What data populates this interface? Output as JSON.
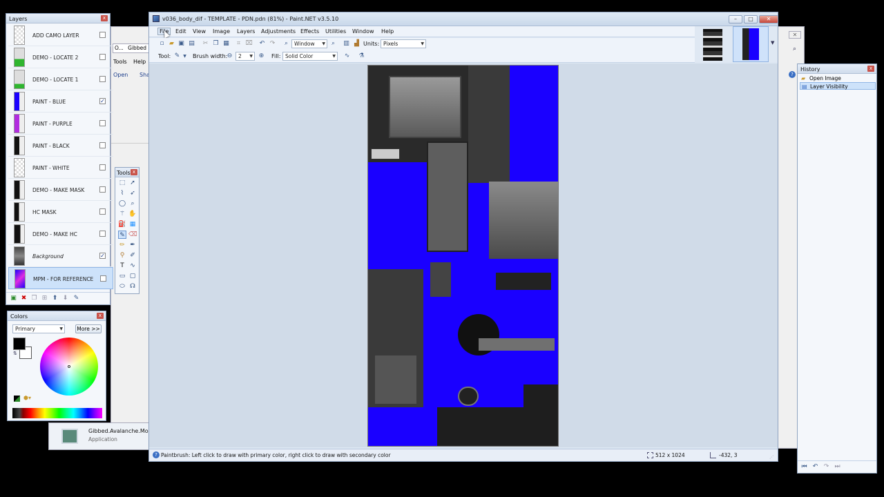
{
  "background": {
    "explorer_address": "Gibbed",
    "explorer_address_prefix": "O...",
    "explorer_menu": [
      "Tools",
      "Help"
    ],
    "explorer_toolbar": [
      "Open",
      "Sha"
    ],
    "taskbar_item_title": "Gibbed.Avalanche.Mod",
    "taskbar_item_subtitle": "Application"
  },
  "window": {
    "title": "v036_body_dif - TEMPLATE - PDN.pdn (81%) - Paint.NET v3.5.10",
    "min": "–",
    "max": "□",
    "close": "✕"
  },
  "menu": [
    "File",
    "Edit",
    "View",
    "Image",
    "Layers",
    "Adjustments",
    "Effects",
    "Utilities",
    "Window",
    "Help"
  ],
  "toolbar": {
    "zoom_mode": "Window",
    "units_label": "Units:",
    "units_value": "Pixels",
    "tool_label": "Tool:",
    "brush_width_label": "Brush width:",
    "brush_width_value": "2",
    "fill_label": "Fill:",
    "fill_value": "Solid Color"
  },
  "status": {
    "hint": "Paintbrush: Left click to draw with primary color, right click to draw with secondary color",
    "image_size": "512 x 1024",
    "cursor": "-432, 3"
  },
  "layers_panel": {
    "title": "Layers",
    "close": "x",
    "items": [
      {
        "name": "ADD CAMO LAYER",
        "checked": ""
      },
      {
        "name": "DEMO - LOCATE 2",
        "checked": ""
      },
      {
        "name": "DEMO - LOCATE 1",
        "checked": ""
      },
      {
        "name": "PAINT - BLUE",
        "checked": "✓"
      },
      {
        "name": "PAINT - PURPLE",
        "checked": ""
      },
      {
        "name": "PAINT - BLACK",
        "checked": ""
      },
      {
        "name": "PAINT - WHITE",
        "checked": ""
      },
      {
        "name": "DEMO - MAKE MASK",
        "checked": ""
      },
      {
        "name": "HC MASK",
        "checked": ""
      },
      {
        "name": "DEMO - MAKE HC",
        "checked": ""
      },
      {
        "name": "Background",
        "checked": "✓"
      },
      {
        "name": "MPM - FOR REFERENCE",
        "checked": ""
      }
    ]
  },
  "tools_panel": {
    "title": "Tools",
    "close": "x"
  },
  "colors_panel": {
    "title": "Colors",
    "close": "x",
    "mode": "Primary",
    "more_button": "More >>"
  },
  "history_panel": {
    "title": "History",
    "close": "x",
    "items": [
      "Open Image",
      "Layer Visibility"
    ]
  },
  "colors": {
    "canvas_blue": "#1a00ff",
    "primary": "#000000",
    "secondary": "#ffffff",
    "selection": "#cde2fa"
  }
}
